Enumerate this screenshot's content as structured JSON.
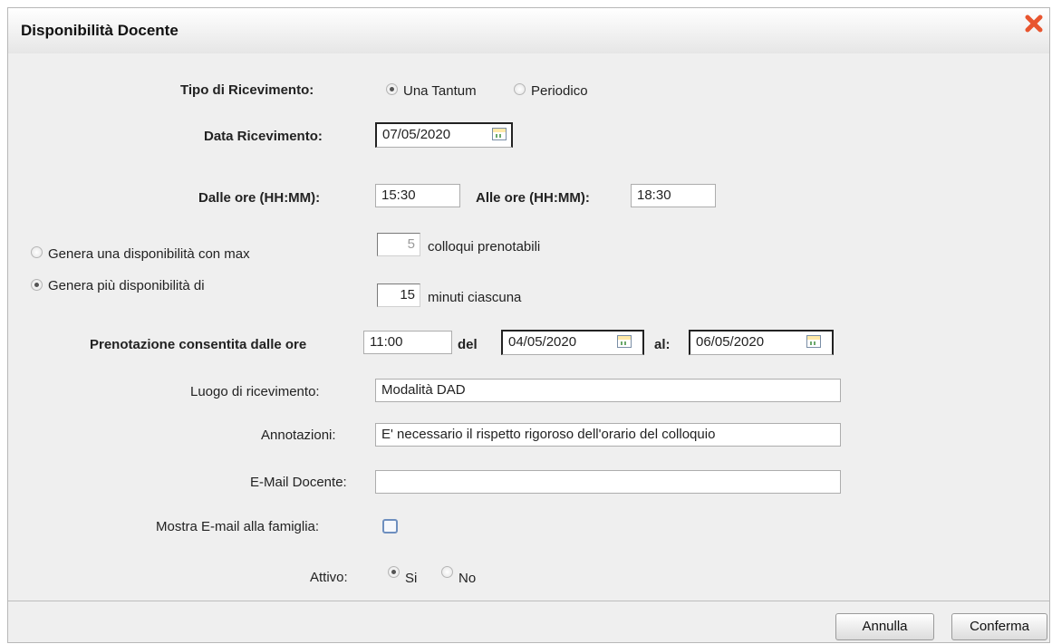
{
  "dialog": {
    "title": "Disponibilità Docente"
  },
  "tipo": {
    "label": "Tipo di Ricevimento:",
    "options": [
      "Una Tantum",
      "Periodico"
    ],
    "selected": "Una Tantum"
  },
  "data_ricevimento": {
    "label": "Data Ricevimento:",
    "value": "07/05/2020"
  },
  "orari": {
    "dalle_label": "Dalle ore (HH:MM):",
    "dalle_value": "15:30",
    "alle_label": "Alle ore (HH:MM):",
    "alle_value": "18:30"
  },
  "genera": {
    "option1_label": "Genera una disponibilità con max",
    "option1_value": "5",
    "option1_suffix": "colloqui prenotabili",
    "option2_label": "Genera più disponibilità di",
    "option2_value": "15",
    "option2_suffix": "minuti ciascuna",
    "selected": "option2"
  },
  "prenotazione": {
    "label": "Prenotazione consentita dalle ore",
    "ora": "11:00",
    "del_label": "del",
    "del_value": "04/05/2020",
    "al_label": "al:",
    "al_value": "06/05/2020"
  },
  "luogo": {
    "label": "Luogo di ricevimento:",
    "value": "Modalità DAD"
  },
  "annotazioni": {
    "label": "Annotazioni:",
    "value": "E' necessario il rispetto rigoroso dell'orario del colloquio"
  },
  "email": {
    "label": "E-Mail Docente:",
    "value": ""
  },
  "mostra_email": {
    "label": "Mostra E-mail alla famiglia:",
    "checked": false
  },
  "attivo": {
    "label": "Attivo:",
    "options": [
      "Si",
      "No"
    ],
    "selected": "Si"
  },
  "buttons": {
    "annulla": "Annulla",
    "conferma": "Conferma"
  },
  "colors": {
    "close": "#e8552f",
    "checkbox_border": "#6e8fbf"
  }
}
